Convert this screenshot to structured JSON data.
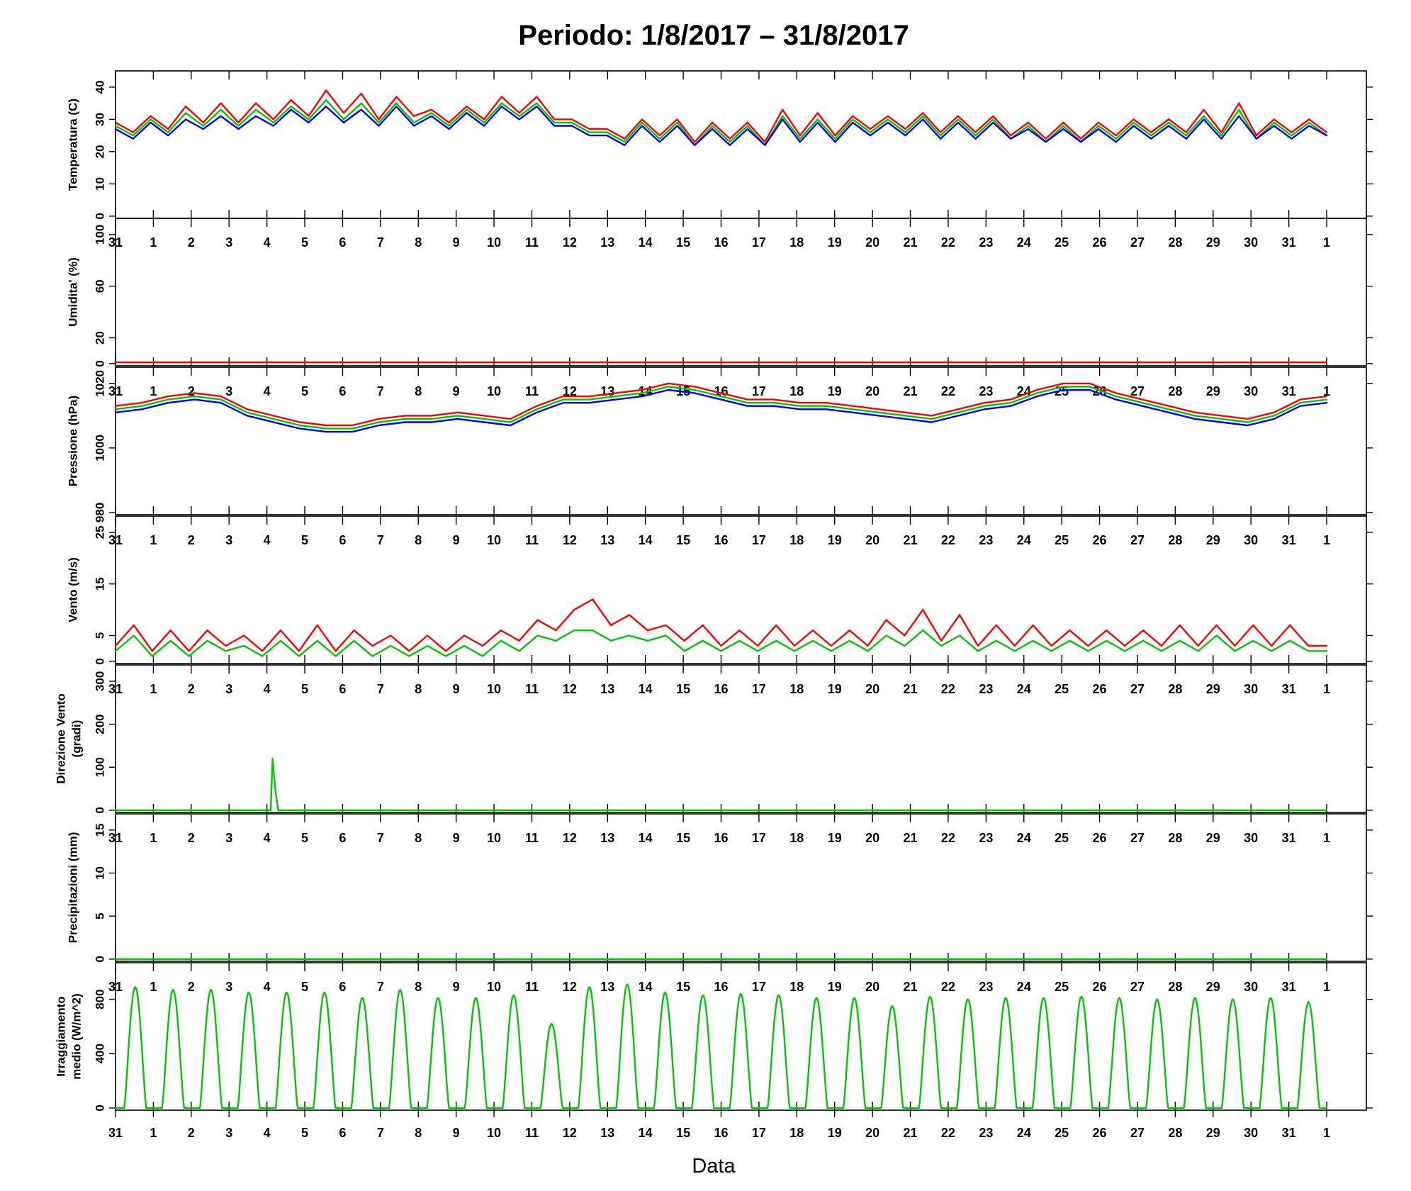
{
  "title": "Periodo:   1/8/2017  –  31/8/2017",
  "colors": {
    "red": "#ff0000",
    "green": "#00c800",
    "blue": "#0000ff"
  },
  "chart_data": {
    "type": "line",
    "title": "Periodo:   1/8/2017  –  31/8/2017",
    "xlabel": "Data",
    "x_tick_labels": [
      "31",
      "1",
      "2",
      "3",
      "4",
      "5",
      "6",
      "7",
      "8",
      "9",
      "10",
      "11",
      "12",
      "13",
      "14",
      "15",
      "16",
      "17",
      "18",
      "19",
      "20",
      "21",
      "22",
      "23",
      "24",
      "25",
      "26",
      "27",
      "28",
      "29",
      "30",
      "31",
      "1"
    ],
    "x_range_days": [
      0,
      32
    ],
    "panels": [
      {
        "id": "temperatura",
        "ylabel": [
          "Temperatura (C)"
        ],
        "ylim": [
          0,
          40
        ],
        "y_ticks": [
          "0",
          "10",
          "20",
          "30",
          "40"
        ],
        "series": [
          {
            "color": "red",
            "values": [
              29,
              26,
              31,
              27,
              34,
              29,
              35,
              29,
              35,
              30,
              36,
              31,
              39,
              32,
              38,
              30,
              37,
              31,
              33,
              29,
              34,
              30,
              37,
              32,
              37,
              30,
              30,
              27,
              27,
              24,
              30,
              25,
              30,
              23,
              29,
              24,
              29,
              23,
              33,
              25,
              32,
              25,
              31,
              27,
              31,
              27,
              32,
              26,
              31,
              26,
              31,
              25,
              29,
              24,
              29,
              24,
              29,
              25,
              30,
              26,
              30,
              26,
              33,
              26,
              35,
              25,
              30,
              26,
              30,
              26
            ]
          },
          {
            "color": "green",
            "values": [
              28,
              25,
              30,
              26,
              32,
              28,
              33,
              28,
              33,
              29,
              34,
              30,
              36,
              30,
              35,
              29,
              35,
              29,
              32,
              28,
              33,
              29,
              35,
              31,
              35,
              29,
              29,
              26,
              26,
              23,
              29,
              24,
              29,
              22,
              28,
              23,
              28,
              22,
              31,
              24,
              30,
              24,
              30,
              26,
              30,
              26,
              31,
              25,
              30,
              25,
              30,
              24,
              28,
              23,
              28,
              23,
              28,
              24,
              29,
              25,
              29,
              25,
              31,
              25,
              33,
              24,
              29,
              25,
              29,
              25
            ]
          },
          {
            "color": "blue",
            "values": [
              27,
              24,
              29,
              25,
              30,
              27,
              31,
              27,
              31,
              28,
              33,
              29,
              34,
              29,
              33,
              28,
              34,
              28,
              31,
              27,
              32,
              28,
              34,
              30,
              34,
              28,
              28,
              25,
              25,
              22,
              28,
              23,
              28,
              22,
              27,
              22,
              27,
              22,
              30,
              23,
              29,
              23,
              29,
              25,
              29,
              25,
              30,
              24,
              29,
              24,
              29,
              24,
              27,
              23,
              27,
              23,
              27,
              23,
              28,
              24,
              28,
              24,
              30,
              24,
              31,
              24,
              28,
              24,
              28,
              25
            ]
          }
        ]
      },
      {
        "id": "umidita",
        "ylabel": [
          "Umidita' (%)"
        ],
        "ylim": [
          0,
          100
        ],
        "y_ticks": [
          "0",
          "20",
          "60",
          "100"
        ],
        "series": [
          {
            "color": "red",
            "values": [
              1,
              1
            ]
          }
        ]
      },
      {
        "id": "pressione",
        "ylabel": [
          "Pressione (hPa)"
        ],
        "ylim": [
          980,
          1020
        ],
        "y_ticks": [
          "980",
          "1000",
          "1020"
        ],
        "series": [
          {
            "color": "red",
            "values": [
              1013,
              1014,
              1016,
              1017,
              1016,
              1012,
              1010,
              1008,
              1007,
              1007,
              1009,
              1010,
              1010,
              1011,
              1010,
              1009,
              1013,
              1016,
              1016,
              1017,
              1018,
              1020,
              1019,
              1017,
              1015,
              1015,
              1014,
              1014,
              1013,
              1012,
              1011,
              1010,
              1012,
              1014,
              1015,
              1018,
              1020,
              1020,
              1017,
              1015,
              1013,
              1011,
              1010,
              1009,
              1011,
              1015,
              1016
            ]
          },
          {
            "color": "green",
            "values": [
              1012,
              1013,
              1015,
              1016,
              1015,
              1011,
              1009,
              1007,
              1006,
              1006,
              1008,
              1009,
              1009,
              1010,
              1009,
              1008,
              1012,
              1015,
              1015,
              1016,
              1017,
              1019,
              1018,
              1016,
              1014,
              1014,
              1013,
              1013,
              1012,
              1011,
              1010,
              1009,
              1011,
              1013,
              1014,
              1017,
              1019,
              1019,
              1016,
              1014,
              1012,
              1010,
              1009,
              1008,
              1010,
              1014,
              1015
            ]
          },
          {
            "color": "blue",
            "values": [
              1011,
              1012,
              1014,
              1015,
              1014,
              1010,
              1008,
              1006,
              1005,
              1005,
              1007,
              1008,
              1008,
              1009,
              1008,
              1007,
              1011,
              1014,
              1014,
              1015,
              1016,
              1018,
              1017,
              1015,
              1013,
              1013,
              1012,
              1012,
              1011,
              1010,
              1009,
              1008,
              1010,
              1012,
              1013,
              1016,
              1018,
              1018,
              1015,
              1013,
              1011,
              1009,
              1008,
              1007,
              1009,
              1013,
              1014
            ]
          }
        ]
      },
      {
        "id": "vento",
        "ylabel": [
          "Vento (m/s)"
        ],
        "ylim": [
          0,
          25
        ],
        "y_ticks": [
          "0",
          "5",
          "15",
          "25"
        ],
        "series": [
          {
            "color": "red",
            "values": [
              3,
              7,
              2,
              6,
              2,
              6,
              3,
              5,
              2,
              6,
              2,
              7,
              2,
              6,
              3,
              5,
              2,
              5,
              2,
              5,
              3,
              6,
              4,
              8,
              6,
              10,
              12,
              7,
              9,
              6,
              7,
              4,
              7,
              3,
              6,
              3,
              7,
              3,
              6,
              3,
              6,
              3,
              8,
              5,
              10,
              4,
              9,
              3,
              7,
              3,
              7,
              3,
              6,
              3,
              6,
              3,
              6,
              3,
              7,
              3,
              7,
              3,
              7,
              3,
              7,
              3,
              3
            ]
          },
          {
            "color": "green",
            "values": [
              2,
              5,
              1,
              4,
              1,
              4,
              2,
              3,
              1,
              4,
              1,
              4,
              1,
              4,
              1,
              3,
              1,
              3,
              1,
              3,
              1,
              4,
              2,
              5,
              4,
              6,
              6,
              4,
              5,
              4,
              5,
              2,
              4,
              2,
              4,
              2,
              4,
              2,
              4,
              2,
              4,
              2,
              5,
              3,
              6,
              3,
              5,
              2,
              4,
              2,
              4,
              2,
              4,
              2,
              4,
              2,
              4,
              2,
              4,
              2,
              5,
              2,
              4,
              2,
              4,
              2,
              2
            ]
          }
        ]
      },
      {
        "id": "direzione",
        "ylabel": [
          "Direzione Vento",
          "(gradi)"
        ],
        "ylim": [
          0,
          300
        ],
        "y_ticks": [
          "0",
          "100",
          "200",
          "300"
        ],
        "series": [
          {
            "color": "green",
            "x": [
              0,
              4.1,
              4.15,
              4.22,
              4.3,
              32
            ],
            "values": [
              0,
              0,
              120,
              50,
              0,
              0
            ]
          }
        ]
      },
      {
        "id": "precipitazioni",
        "ylabel": [
          "Precipitazioni (mm)"
        ],
        "ylim": [
          0,
          15
        ],
        "y_ticks": [
          "0",
          "5",
          "10",
          "15"
        ],
        "series": [
          {
            "color": "green",
            "values": [
              0,
              0
            ]
          }
        ]
      },
      {
        "id": "irraggiamento",
        "ylabel": [
          "Irraggiamento",
          "medio (W/m^2)"
        ],
        "ylim": [
          0,
          950
        ],
        "y_ticks": [
          "0",
          "400",
          "800"
        ],
        "series": [
          {
            "color": "green",
            "daily_peak_W_m2": [
              890,
              870,
              870,
              850,
              850,
              850,
              810,
              870,
              810,
              810,
              830,
              620,
              890,
              910,
              850,
              830,
              840,
              830,
              810,
              810,
              750,
              820,
              800,
              810,
              810,
              820,
              810,
              800,
              810,
              800,
              810,
              780
            ]
          }
        ]
      }
    ]
  }
}
